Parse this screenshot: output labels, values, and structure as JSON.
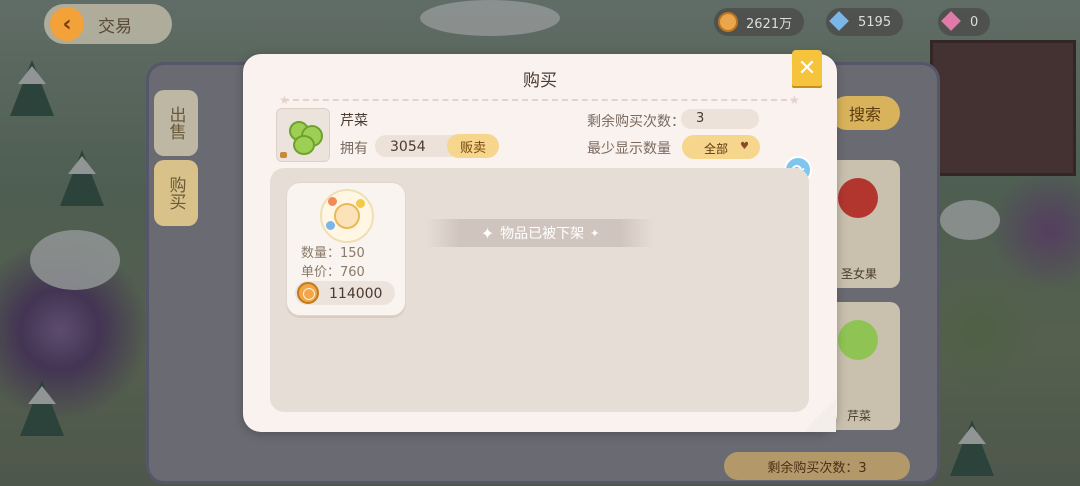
{
  "top_bar": {
    "back_label": "交易",
    "coins": "2621万",
    "gems": "5195",
    "third_currency": "0"
  },
  "trade_panel": {
    "tab_sell": "出售",
    "tab_buy": "购买",
    "search_label": "搜索",
    "cards": [
      {
        "label": "圣女果"
      },
      {
        "label": "芹菜"
      }
    ],
    "remaining_label": "剩余购买次数：3"
  },
  "modal": {
    "title": "购买",
    "item_name": "芹菜",
    "owned_label": "拥有",
    "owned_value": "3054",
    "sell_button": "贩卖",
    "remaining_label": "剩余购买次数：",
    "remaining_value": "3",
    "min_display_label": "最少显示数量",
    "filter_value": "全部",
    "listing": {
      "qty_label": "数量：",
      "qty_value": "150",
      "price_label": "单价：",
      "price_value": "760",
      "total": "114000"
    },
    "delisted_text": "物品已被下架"
  },
  "colors": {
    "accent": "#f6c33d",
    "modal_bg": "#f9f2ee",
    "refresh": "#7ec6ee"
  },
  "icons": [
    "back-arrow-icon",
    "coin-icon",
    "gem-icon",
    "close-icon",
    "refresh-icon",
    "heart-icon",
    "sparkle-icon"
  ]
}
